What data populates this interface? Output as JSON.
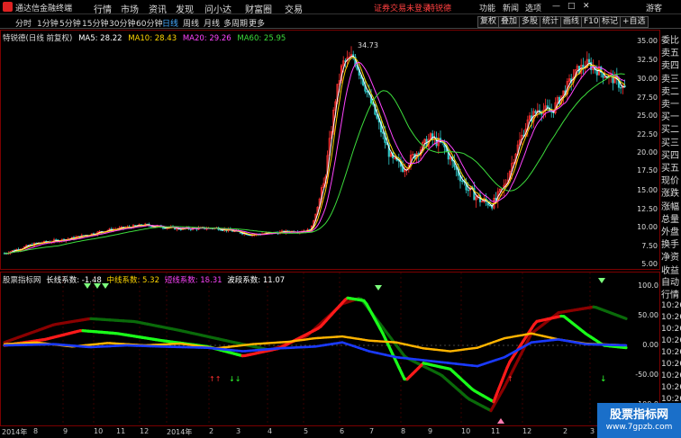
{
  "app": {
    "title": "通达信金融终端"
  },
  "menu": [
    "行情",
    "市场",
    "资讯",
    "发现",
    "问小达",
    "财富圈",
    "交易"
  ],
  "alert": "证券交易未登录",
  "user_tag": "特锐德",
  "menu_right": [
    "功能",
    "新闻",
    "选项"
  ],
  "guest": "游客",
  "periods": [
    "分时",
    "1分钟",
    "5分钟",
    "15分钟",
    "30分钟",
    "60分钟",
    "日线",
    "周线",
    "月线",
    "多周期",
    "更多"
  ],
  "active_period": "日线",
  "toolbar_buttons": [
    "复权",
    "叠加",
    "多股",
    "统计",
    "画线",
    "F10",
    "标记",
    "+自选"
  ],
  "stock": {
    "name": "特锐德",
    "mode": "(日线 前复权)"
  },
  "ma_legend": [
    {
      "label": "MA5: 28.22",
      "color": "#ffffff"
    },
    {
      "label": "MA10: 28.43",
      "color": "#ffd700"
    },
    {
      "label": "MA20: 29.26",
      "color": "#ff44ff"
    },
    {
      "label": "MA60: 25.95",
      "color": "#3cdc3c"
    }
  ],
  "peak_label": "34.73",
  "price_axis": [
    "35.00",
    "32.50",
    "30.00",
    "27.50",
    "25.00",
    "22.50",
    "20.00",
    "17.50",
    "15.00",
    "12.50",
    "10.00",
    "7.50",
    "5.00"
  ],
  "indicator_axis": [
    "100.0",
    "50.00",
    "0.00",
    "-50.00",
    "-100.0"
  ],
  "indicator_legend": {
    "name": "股票指标网",
    "items": [
      {
        "label": "长线系数: -1.48",
        "color": "#ffffff"
      },
      {
        "label": "中线系数: 5.32",
        "color": "#ffd700"
      },
      {
        "label": "短线系数: 18.31",
        "color": "#ff44ff"
      },
      {
        "label": "波段系数: 11.07",
        "color": "#ffffff"
      }
    ]
  },
  "side_panel": [
    "委比",
    "卖五",
    "卖四",
    "卖三",
    "卖二",
    "卖一",
    "买一",
    "买二",
    "买三",
    "买四",
    "买五",
    "现价",
    "涨跌",
    "涨幅",
    "总量",
    "外盘",
    "换手",
    "净资",
    "收益"
  ],
  "side_panel_bottom": [
    "自动",
    "行情"
  ],
  "side_times": [
    "10:26",
    "10:26",
    "10:26",
    "10:26",
    "10:26",
    "10:26",
    "10:26",
    "10:26",
    "10:26"
  ],
  "date_labels": [
    "2014年",
    "8",
    "9",
    "10",
    "11",
    "12",
    "2014年",
    "2",
    "3",
    "4",
    "5",
    "6",
    "7",
    "8",
    "9",
    "10",
    "11",
    "12",
    "2",
    "3",
    "4"
  ],
  "watermark": {
    "title": "股票指标网",
    "url": "www.7gpzb.com"
  },
  "colors": {
    "border": "#7a0000",
    "up": "#ff3030",
    "down": "#30c8c8",
    "ma5": "#ffffff",
    "ma10": "#ffd700",
    "ma20": "#ff44ff",
    "ma60": "#3cdc3c"
  }
}
